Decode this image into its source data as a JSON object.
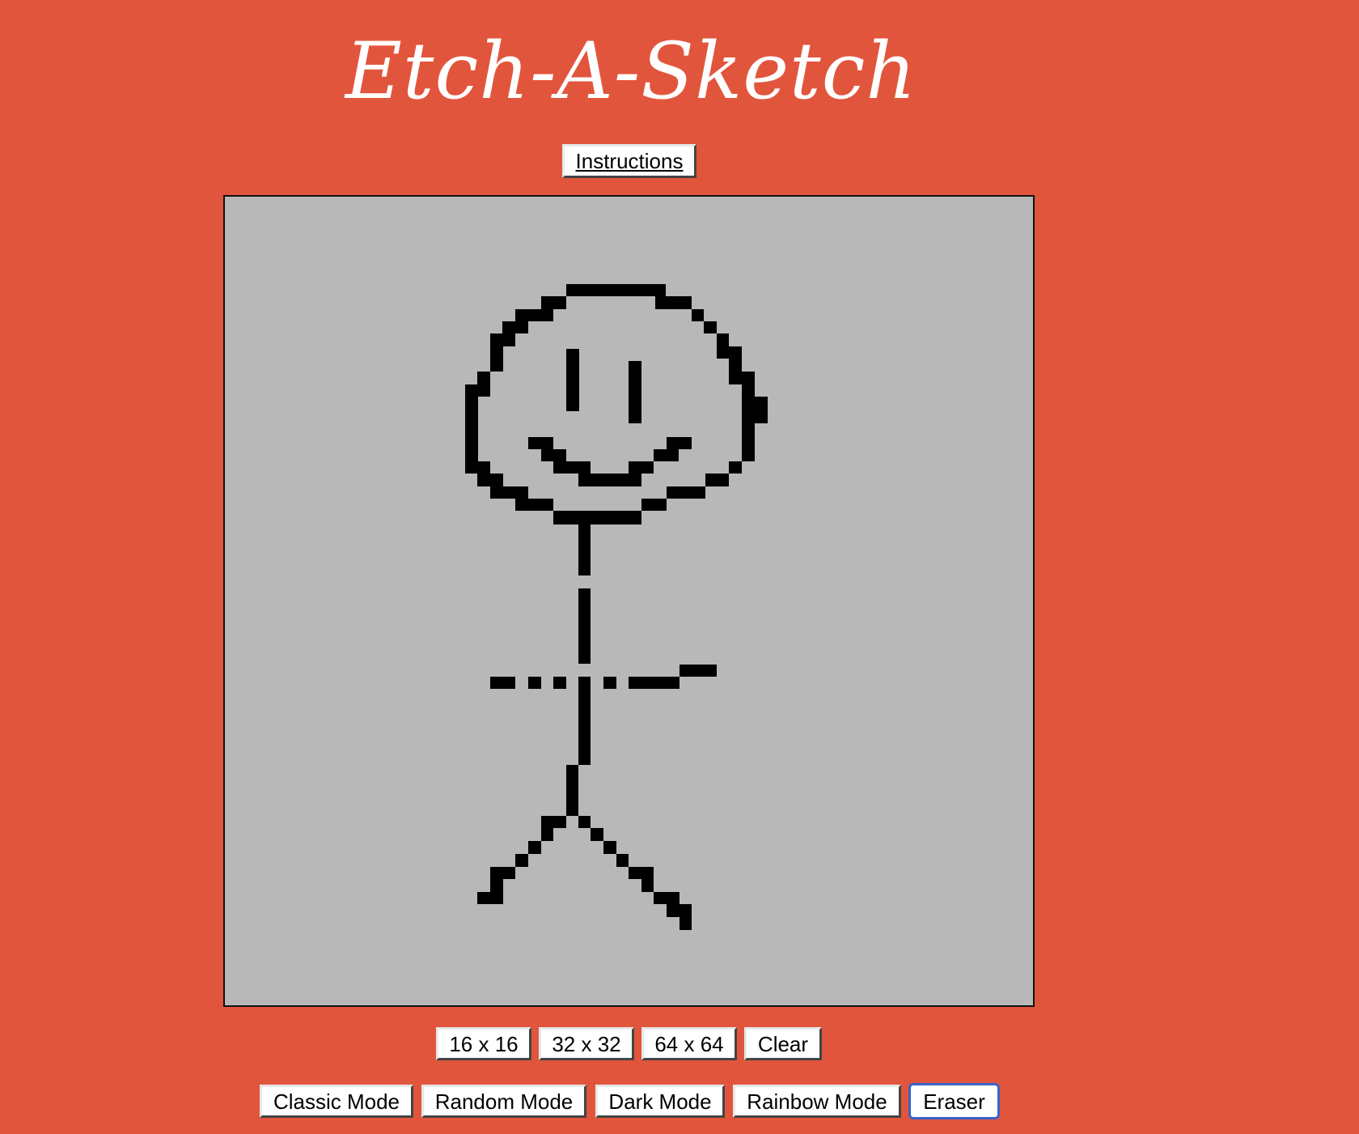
{
  "app": {
    "title": "Etch-A-Sketch"
  },
  "buttons": {
    "instructions": "Instructions"
  },
  "grid_controls": {
    "size_16": "16 x 16",
    "size_32": "32 x 32",
    "size_64": "64 x 64",
    "clear": "Clear"
  },
  "mode_controls": {
    "classic": "Classic Mode",
    "random": "Random Mode",
    "dark": "Dark Mode",
    "rainbow": "Rainbow Mode",
    "eraser": "Eraser",
    "active_mode": "eraser"
  },
  "board": {
    "grid_size": 64,
    "background_color": "#b8b8b8",
    "ink_color": "#000000",
    "drawing": "stick figure with smiley face"
  },
  "colors": {
    "page_background": "#e2553d",
    "title_color": "#ffffff",
    "active_border": "#3a63c9"
  }
}
